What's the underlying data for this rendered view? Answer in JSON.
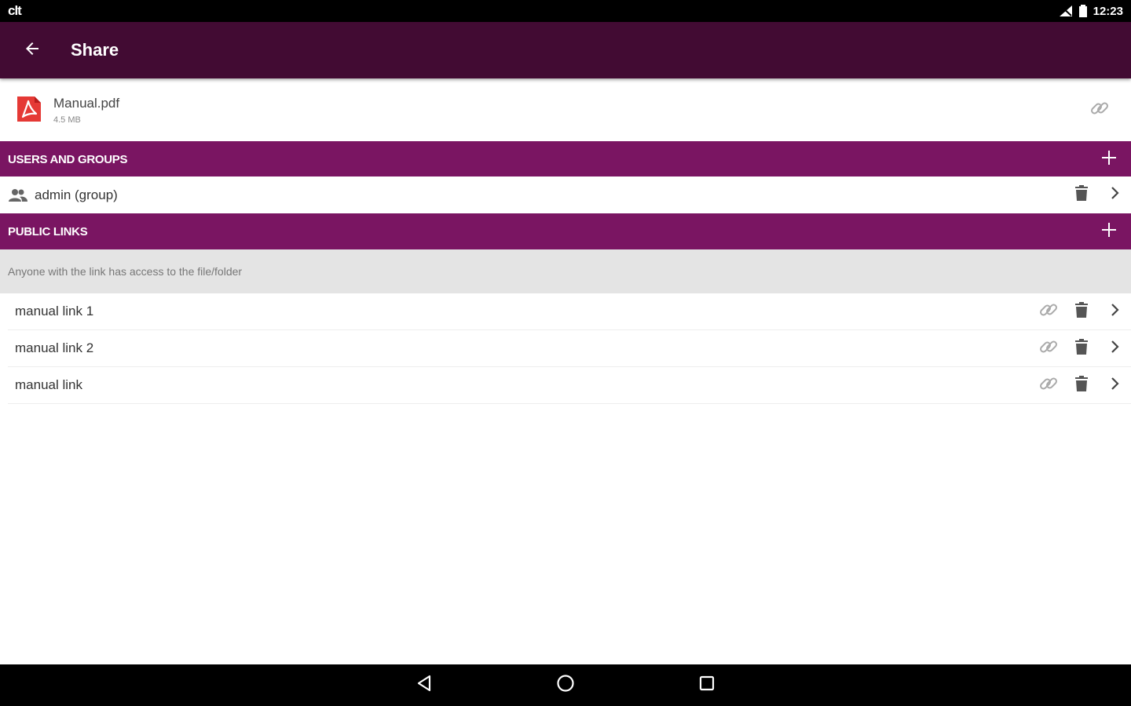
{
  "status_bar": {
    "left_label": "clt",
    "time": "12:23"
  },
  "app_bar": {
    "title": "Share"
  },
  "file": {
    "name": "Manual.pdf",
    "size": "4.5 MB"
  },
  "users_section": {
    "title": "USERS AND GROUPS",
    "items": [
      {
        "label": "admin (group)"
      }
    ]
  },
  "links_section": {
    "title": "PUBLIC LINKS",
    "info": "Anyone with the link has access to the file/folder",
    "items": [
      {
        "label": "manual link 1"
      },
      {
        "label": "manual link 2"
      },
      {
        "label": "manual link"
      }
    ]
  },
  "colors": {
    "app_bar": "#420b33",
    "section_header": "#7a1562",
    "info_strip": "#e4e4e4",
    "pdf_red": "#e53935"
  },
  "icons": {
    "back": "arrow-left-icon",
    "file": "pdf-icon",
    "link": "link-icon",
    "add": "plus-icon",
    "group": "group-icon",
    "delete": "trash-icon",
    "details": "chevron-right-icon",
    "nav_back": "triangle-back-icon",
    "nav_home": "circle-home-icon",
    "nav_recents": "square-recents-icon"
  }
}
